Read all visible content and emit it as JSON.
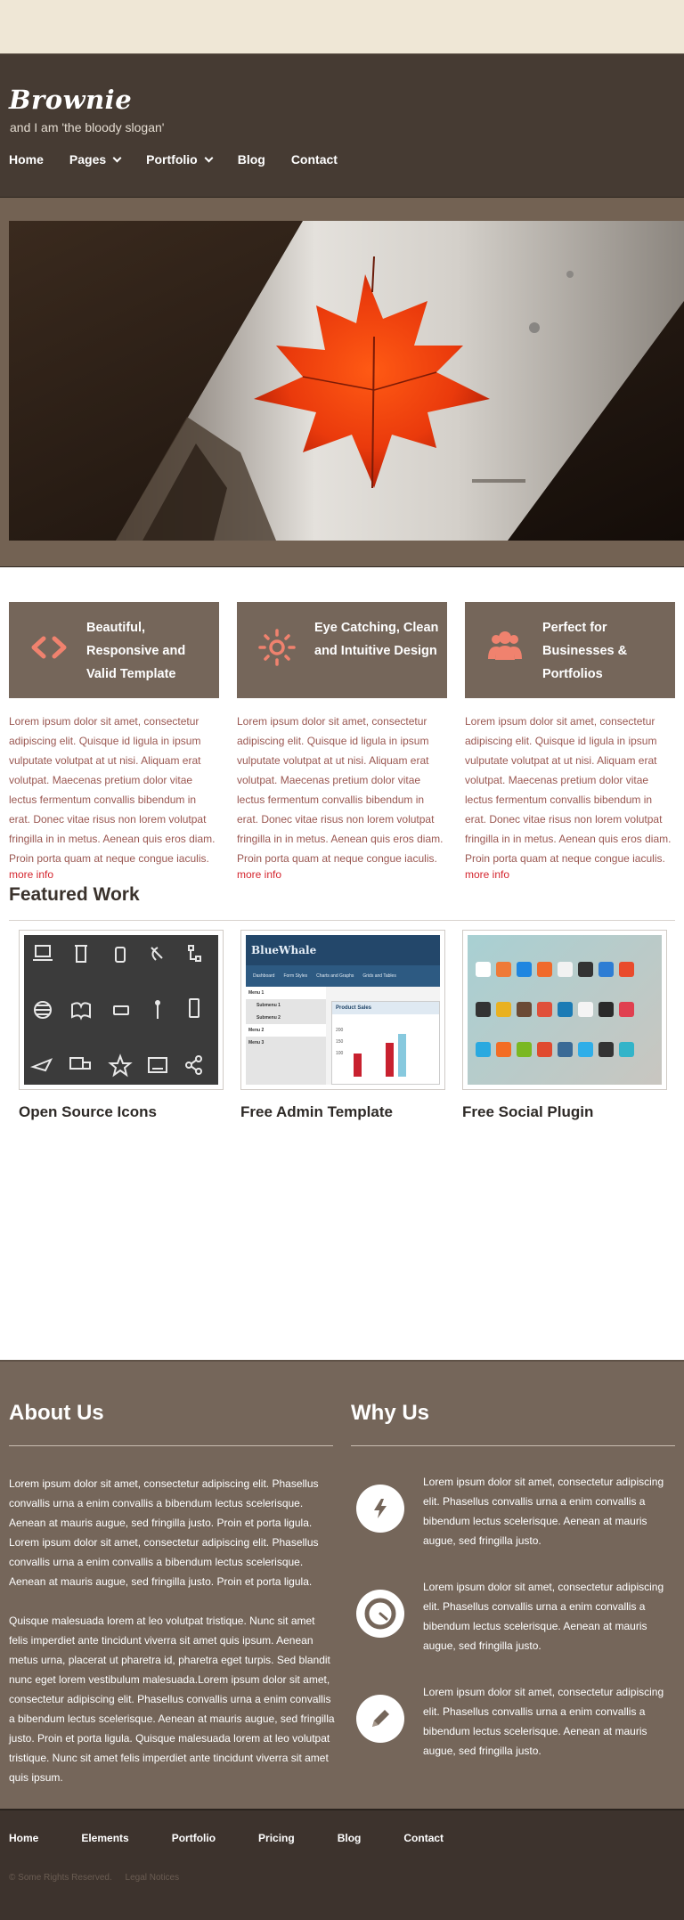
{
  "brand": {
    "logo": "Brownie",
    "slogan": "and I am 'the bloody slogan'"
  },
  "nav": [
    {
      "label": "Home",
      "dropdown": false
    },
    {
      "label": "Pages",
      "dropdown": true
    },
    {
      "label": "Portfolio",
      "dropdown": true
    },
    {
      "label": "Blog",
      "dropdown": false
    },
    {
      "label": "Contact",
      "dropdown": false
    }
  ],
  "features": [
    {
      "icon": "code-icon",
      "title": "Beautiful, Responsive and Valid Template",
      "text": "Lorem ipsum dolor sit amet, consectetur adipiscing elit. Quisque id ligula in ipsum vulputate volutpat at ut nisi. Aliquam erat volutpat. Maecenas pretium dolor vitae lectus fermentum convallis bibendum in erat. Donec vitae risus non lorem volutpat fringilla in in metus. Aenean quis eros diam. Proin porta quam at neque congue iaculis.",
      "more": "more info"
    },
    {
      "icon": "sun-icon",
      "title": "Eye Catching, Clean and Intuitive Design",
      "text": "Lorem ipsum dolor sit amet, consectetur adipiscing elit. Quisque id ligula in ipsum vulputate volutpat at ut nisi. Aliquam erat volutpat. Maecenas pretium dolor vitae lectus fermentum convallis bibendum in erat. Donec vitae risus non lorem volutpat fringilla in in metus. Aenean quis eros diam. Proin porta quam at neque congue iaculis.",
      "more": "more info"
    },
    {
      "icon": "users-icon",
      "title": "Perfect for Businesses & Portfolios",
      "text": "Lorem ipsum dolor sit amet, consectetur adipiscing elit. Quisque id ligula in ipsum vulputate volutpat at ut nisi. Aliquam erat volutpat. Maecenas pretium dolor vitae lectus fermentum convallis bibendum in erat. Donec vitae risus non lorem volutpat fringilla in in metus. Aenean quis eros diam. Proin porta quam at neque congue iaculis.",
      "more": "more info"
    }
  ],
  "featured": {
    "title": "Featured Work",
    "items": [
      {
        "title": "Open Source Icons"
      },
      {
        "title": "Free Admin Template",
        "thumb": {
          "brand": "BlueWhale",
          "tabs": [
            "Dashboard",
            "Form Styles",
            "Charts and Graphs",
            "Grids and Tables"
          ],
          "menu": [
            "Menu 1",
            "Submenu 1",
            "Submenu 2",
            "Menu 2",
            "Menu 3"
          ],
          "panel_title": "Product Sales",
          "axis": [
            "200",
            "150",
            "100"
          ]
        }
      },
      {
        "title": "Free Social Plugin"
      }
    ]
  },
  "about": {
    "title": "About Us",
    "paragraphs": [
      "Lorem ipsum dolor sit amet, consectetur adipiscing elit. Phasellus convallis urna a enim convallis a bibendum lectus scelerisque. Aenean at mauris augue, sed fringilla justo. Proin et porta ligula. Lorem ipsum dolor sit amet, consectetur adipiscing elit. Phasellus convallis urna a enim convallis a bibendum lectus scelerisque. Aenean at mauris augue, sed fringilla justo. Proin et porta ligula.",
      "Quisque malesuada lorem at leo volutpat tristique. Nunc sit amet felis imperdiet ante tincidunt viverra sit amet quis ipsum. Aenean metus urna, placerat ut pharetra id, pharetra eget turpis. Sed blandit nunc eget lorem vestibulum malesuada.Lorem ipsum dolor sit amet, consectetur adipiscing elit. Phasellus convallis urna a enim convallis a bibendum lectus scelerisque. Aenean at mauris augue, sed fringilla justo. Proin et porta ligula. Quisque malesuada lorem at leo volutpat tristique. Nunc sit amet felis imperdiet ante tincidunt viverra sit amet quis ipsum."
    ]
  },
  "why": {
    "title": "Why Us",
    "items": [
      {
        "icon": "lightning-icon",
        "text": "Lorem ipsum dolor sit amet, consectetur adipiscing elit. Phasellus convallis urna a enim convallis a bibendum lectus scelerisque. Aenean at mauris augue, sed fringilla justo."
      },
      {
        "icon": "gauge-icon",
        "text": "Lorem ipsum dolor sit amet, consectetur adipiscing elit. Phasellus convallis urna a enim convallis a bibendum lectus scelerisque. Aenean at mauris augue, sed fringilla justo."
      },
      {
        "icon": "pencil-icon",
        "text": "Lorem ipsum dolor sit amet, consectetur adipiscing elit. Phasellus convallis urna a enim convallis a bibendum lectus scelerisque. Aenean at mauris augue, sed fringilla justo."
      }
    ]
  },
  "footer": {
    "nav": [
      "Home",
      "Elements",
      "Portfolio",
      "Pricing",
      "Blog",
      "Contact"
    ],
    "copyright": "© Some Rights Reserved.",
    "legal": "Legal Notices"
  },
  "colors": {
    "accent": "#f0826e",
    "header": "#463b33",
    "band": "#75665a",
    "link": "#d4252e",
    "top": "#efe7d6"
  }
}
